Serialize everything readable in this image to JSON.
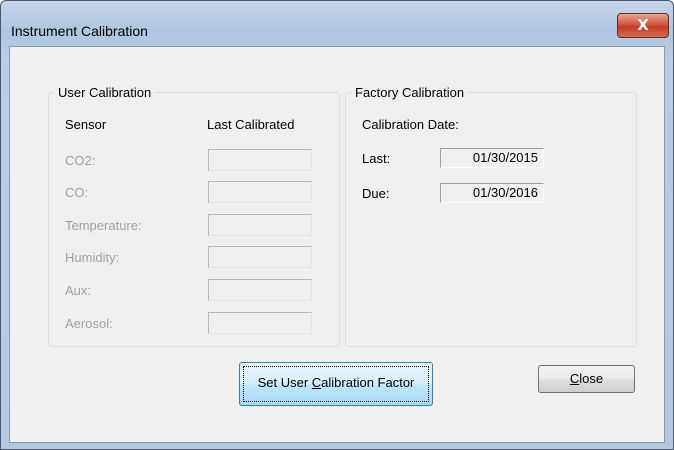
{
  "window": {
    "title": "Instrument Calibration",
    "close_glyph": "X"
  },
  "user_calibration": {
    "legend": "User Calibration",
    "header_sensor": "Sensor",
    "header_last": "Last Calibrated",
    "sensors": [
      {
        "label": "CO2:",
        "value": ""
      },
      {
        "label": "CO:",
        "value": ""
      },
      {
        "label": "Temperature:",
        "value": ""
      },
      {
        "label": "Humidity:",
        "value": ""
      },
      {
        "label": "Aux:",
        "value": ""
      },
      {
        "label": "Aerosol:",
        "value": ""
      }
    ]
  },
  "factory_calibration": {
    "legend": "Factory Calibration",
    "date_header": "Calibration Date:",
    "last_label": "Last:",
    "last_value": "01/30/2015",
    "due_label": "Due:",
    "due_value": "01/30/2016"
  },
  "buttons": {
    "set_pre": "Set User ",
    "set_mnemonic": "C",
    "set_post": "alibration Factor",
    "close_mnemonic": "C",
    "close_post": "lose"
  },
  "icons": {
    "close": "close-icon"
  },
  "colors": {
    "title_bar": "#b9cee4",
    "close_button": "#c33c24",
    "primary_button": "#bee6fd"
  }
}
